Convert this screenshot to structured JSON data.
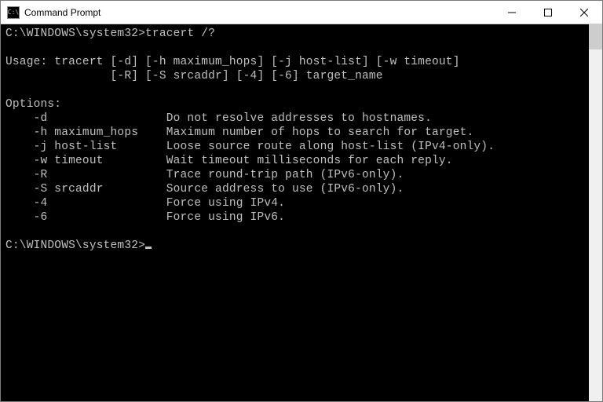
{
  "window": {
    "title": "Command Prompt",
    "icon_label": "C:\\"
  },
  "terminal": {
    "prompt1_path": "C:\\WINDOWS\\system32>",
    "prompt1_cmd": "tracert /?",
    "blank1": "",
    "usage_line1": "Usage: tracert [-d] [-h maximum_hops] [-j host-list] [-w timeout]",
    "usage_line2": "               [-R] [-S srcaddr] [-4] [-6] target_name",
    "blank2": "",
    "options_header": "Options:",
    "opt_d": "    -d                 Do not resolve addresses to hostnames.",
    "opt_h": "    -h maximum_hops    Maximum number of hops to search for target.",
    "opt_j": "    -j host-list       Loose source route along host-list (IPv4-only).",
    "opt_w": "    -w timeout         Wait timeout milliseconds for each reply.",
    "opt_R": "    -R                 Trace round-trip path (IPv6-only).",
    "opt_S": "    -S srcaddr         Source address to use (IPv6-only).",
    "opt_4": "    -4                 Force using IPv4.",
    "opt_6": "    -6                 Force using IPv6.",
    "blank3": "",
    "prompt2_path": "C:\\WINDOWS\\system32>"
  }
}
